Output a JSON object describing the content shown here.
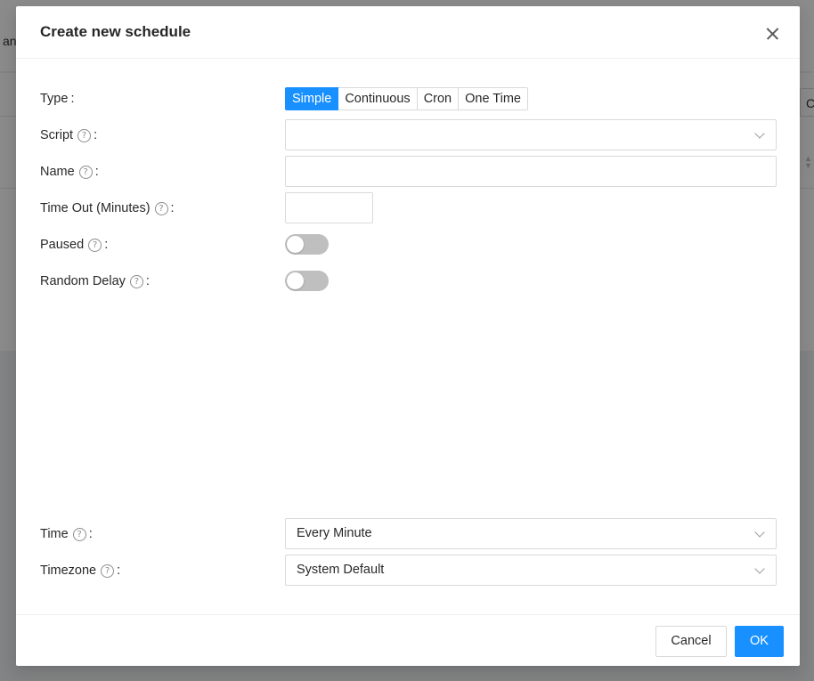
{
  "background": {
    "left_text": "an",
    "right_text": "C"
  },
  "modal": {
    "title": "Create new schedule",
    "fields": {
      "type_label": "Type",
      "type_options": [
        "Simple",
        "Continuous",
        "Cron",
        "One Time"
      ],
      "type_selected": "Simple",
      "script_label": "Script",
      "script_value": "",
      "name_label": "Name",
      "name_value": "",
      "timeout_label": "Time Out (Minutes)",
      "timeout_value": "",
      "paused_label": "Paused",
      "paused_on": false,
      "random_delay_label": "Random Delay",
      "random_delay_on": false,
      "time_label": "Time",
      "time_value": "Every Minute",
      "timezone_label": "Timezone",
      "timezone_value": "System Default"
    },
    "help_glyph": "?",
    "colon": ":",
    "footer": {
      "cancel_label": "Cancel",
      "ok_label": "OK"
    }
  },
  "colors": {
    "primary": "#1890ff",
    "overlay": "rgba(0,0,0,0.45)",
    "switch_off": "#bfbfbf"
  }
}
